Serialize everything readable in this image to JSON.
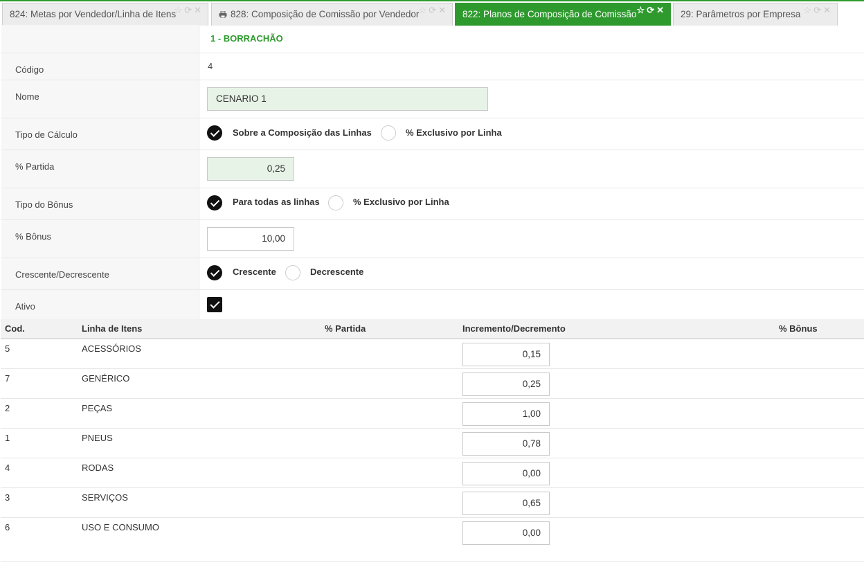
{
  "tabs": [
    {
      "label": "824: Metas por Vendedor/Linha de Itens",
      "icons": [
        "star-icon",
        "refresh-icon",
        "close-icon"
      ]
    },
    {
      "label": "828: Composição de Comissão por Vendedor",
      "icons": [
        "star-icon",
        "refresh-icon",
        "close-icon"
      ]
    },
    {
      "label": "822: Planos de Composição de Comissão",
      "icons": [
        "star-icon",
        "refresh-icon",
        "close-icon"
      ]
    },
    {
      "label": "29: Parâmetros por Empresa",
      "icons": [
        "star-icon",
        "refresh-icon",
        "close-icon"
      ]
    }
  ],
  "colors": {
    "accent": "#2e9a2e",
    "input_green": "#e8f3e8"
  },
  "form": {
    "section_title": "1 - BORRACHÃO",
    "codigo": {
      "label": "Código",
      "value": "4"
    },
    "nome": {
      "label": "Nome",
      "value": "CENARIO 1"
    },
    "tipo_calculo": {
      "label": "Tipo de Cálculo",
      "option1": "Sobre a Composição das Linhas",
      "option2": "% Exclusivo por Linha",
      "selected": 1
    },
    "partida": {
      "label": "% Partida",
      "value": "0,25"
    },
    "tipo_bonus": {
      "label": "Tipo do Bônus",
      "option1": "Para todas as linhas",
      "option2": "% Exclusivo por Linha",
      "selected": 1
    },
    "bonus": {
      "label": "% Bônus",
      "value": "10,00"
    },
    "cresc_decresc": {
      "label": "Crescente/Decrescente",
      "option1": "Crescente",
      "option2": "Decrescente",
      "selected": 1
    },
    "ativo": {
      "label": "Ativo",
      "checked": true
    }
  },
  "table": {
    "headers": {
      "cod": "Cod.",
      "linha": "Linha de Itens",
      "partida": "% Partida",
      "inc": "Incremento/Decremento",
      "bonus": "% Bônus"
    },
    "rows": [
      {
        "cod": "5",
        "linha": "ACESSÓRIOS",
        "inc": "0,15"
      },
      {
        "cod": "7",
        "linha": "GENÉRICO",
        "inc": "0,25"
      },
      {
        "cod": "2",
        "linha": "PEÇAS",
        "inc": "1,00"
      },
      {
        "cod": "1",
        "linha": "PNEUS",
        "inc": "0,78"
      },
      {
        "cod": "4",
        "linha": "RODAS",
        "inc": "0,00"
      },
      {
        "cod": "3",
        "linha": "SERVIÇOS",
        "inc": "0,65"
      },
      {
        "cod": "6",
        "linha": "USO E CONSUMO",
        "inc": "0,00"
      }
    ]
  }
}
